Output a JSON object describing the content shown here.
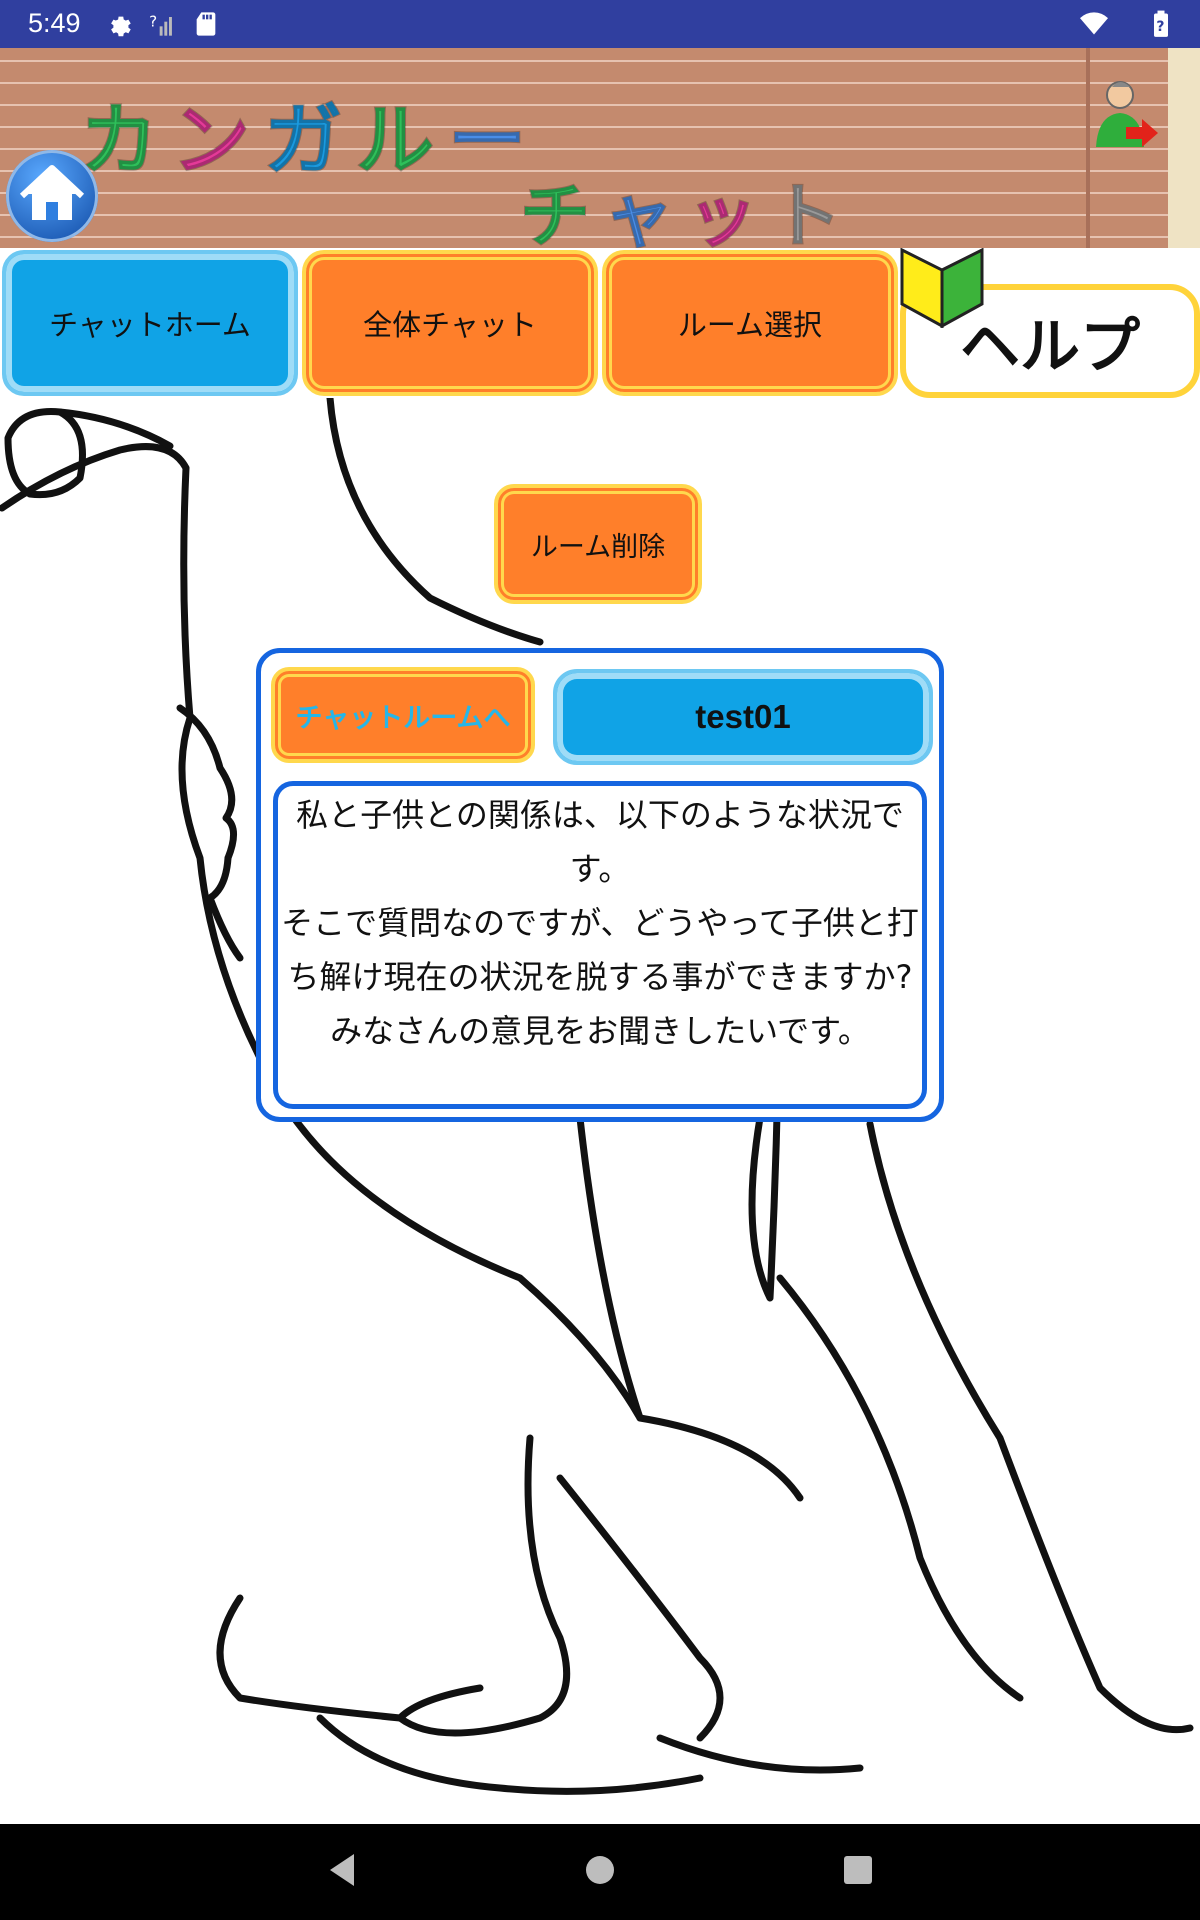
{
  "status_bar": {
    "time": "5:49",
    "icons": [
      "settings-icon",
      "sim-unknown-icon",
      "sd-card-icon",
      "wifi-icon",
      "battery-icon"
    ]
  },
  "banner": {
    "title_line1": "カンガルー",
    "title_line2": "チャット",
    "title_colors": [
      "#2ec05a",
      "#e53998",
      "#1a9ae0",
      "#2ec05a",
      "#4a8ee8",
      "#e53998",
      "#9a9a9a"
    ],
    "home_icon": "home-icon",
    "logout_icon": "logout-icon"
  },
  "nav": {
    "chat_home": "チャットホーム",
    "global_chat": "全体チャット",
    "room_select": "ルーム選択",
    "help": "ヘルプ"
  },
  "actions": {
    "delete_room": "ルーム削除"
  },
  "room_card": {
    "enter_label": "チャットルームへ",
    "room_name": "test01",
    "description": "私と子供との関係は、以下のような状況です。\nそこで質問なのですが、どうやって子供と打ち解け現在の状況を脱する事ができますか?\nみなさんの意見をお聞きしたいです。"
  },
  "colors": {
    "status_bar": "#303f9f",
    "accent_blue": "#10a3e6",
    "accent_orange": "#ff7f2a",
    "border_yellow": "#ffd84d",
    "card_border": "#1565e0"
  },
  "system_nav": [
    "back-icon",
    "home-circle-icon",
    "recents-icon"
  ]
}
